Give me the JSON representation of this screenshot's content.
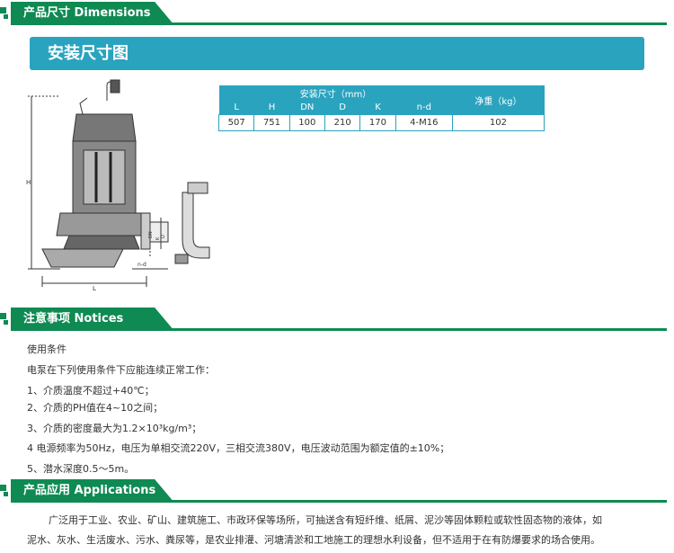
{
  "sections": {
    "dimensions": {
      "title": "产品尺寸  Dimensions"
    },
    "notices": {
      "title": "注意事项  Notices"
    },
    "applications": {
      "title": "产品应用  Applications"
    }
  },
  "banner": {
    "title": "安装尺寸图"
  },
  "dimension_table": {
    "group_header": "安装尺寸（mm）",
    "weight_header": "净重（kg）",
    "columns": [
      "L",
      "H",
      "DN",
      "D",
      "K",
      "n-d"
    ],
    "row": [
      "507",
      "751",
      "100",
      "210",
      "170",
      "4-M16"
    ],
    "weight": "102"
  },
  "diagram": {
    "labels": {
      "H": "H",
      "L": "L",
      "nd": "n-d",
      "DN": "DN",
      "K": "K",
      "D": "D"
    }
  },
  "notices": {
    "heading": "使用条件",
    "intro": "电泵在下列使用条件下应能连续正常工作：",
    "items": [
      "1、介质温度不超过+40℃；",
      "2、介质的PH值在4~10之间；",
      "3、介质的密度最大为1.2×10³kg/m³；",
      "4 电源频率为50Hz，电压为单相交流220V，三相交流380V，电压波动范围为额定值的±10%；",
      "5、潜水深度0.5～5m。"
    ]
  },
  "applications": {
    "line1": "广泛用于工业、农业、矿山、建筑施工、市政环保等场所，可抽送含有短纤维、纸屑、泥沙等固体颗粒或软性固态物的液体，如",
    "line2": "泥水、灰水、生活废水、污水、粪尿等，是农业排灌、河塘清淤和工地施工的理想水利设备，但不适用于在有防爆要求的场合使用。"
  },
  "colors": {
    "green": "#0e8a52",
    "blue": "#2aa3bf"
  }
}
